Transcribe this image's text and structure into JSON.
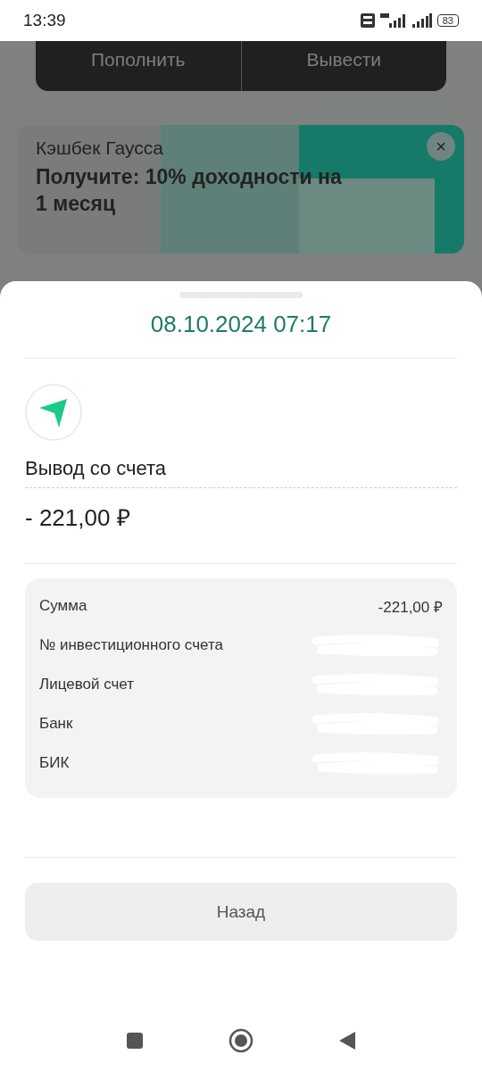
{
  "status_bar": {
    "time": "13:39",
    "battery": "83"
  },
  "top_actions": [
    "Пополнить",
    "Вывести"
  ],
  "promo": {
    "title": "Кэшбек Гаусса",
    "text": "Получите: 10% доходности на 1 месяц",
    "close": "×"
  },
  "sheet": {
    "date": "08.10.2024 07:17",
    "operation": "Вывод со счета",
    "amount": "- 221,00 ₽",
    "details": [
      {
        "label": "Сумма",
        "value": "-221,00 ₽",
        "redacted": false
      },
      {
        "label": "№ инвестиционного счета",
        "redacted": true
      },
      {
        "label": "Лицевой счет",
        "redacted": true
      },
      {
        "label": "Банк",
        "redacted": true
      },
      {
        "label": "БИК",
        "redacted": true
      }
    ],
    "back_button": "Назад"
  }
}
